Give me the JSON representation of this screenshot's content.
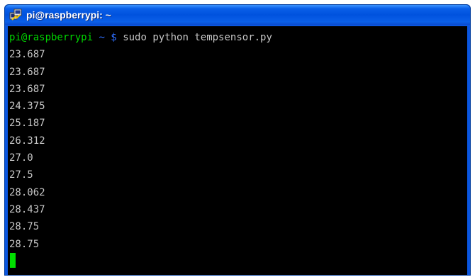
{
  "window": {
    "title": "pi@raspberrypi: ~",
    "icon": "putty-icon"
  },
  "terminal": {
    "prompt_user": "pi@raspberrypi",
    "prompt_path": "~ $",
    "command": "sudo python tempsensor.py",
    "output": [
      "23.687",
      "23.687",
      "23.687",
      "24.375",
      "25.187",
      "26.312",
      "27.0",
      "27.5",
      "28.062",
      "28.437",
      "28.75",
      "28.75"
    ]
  },
  "colors": {
    "title_bar": "#0052de",
    "terminal_bg": "#000000",
    "text": "#c6c6c6",
    "prompt_user": "#00d400",
    "prompt_path": "#2f6fff",
    "cursor": "#00e000"
  }
}
